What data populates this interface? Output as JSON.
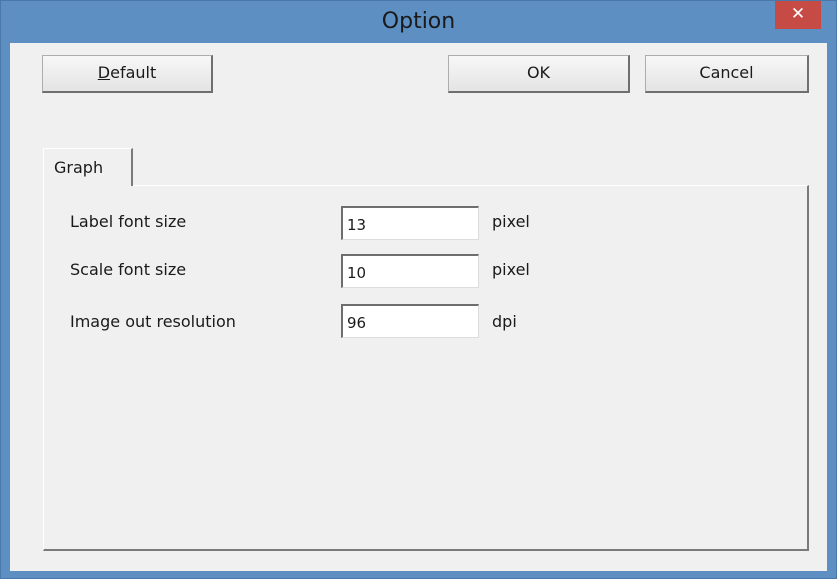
{
  "window": {
    "title": "Option",
    "close_glyph": "✕"
  },
  "buttons": {
    "default_label_underlined": "D",
    "default_label_rest": "efault",
    "ok_label": "OK",
    "cancel_label": "Cancel"
  },
  "tabs": [
    {
      "label": "Graph",
      "active": true
    }
  ],
  "settings": [
    {
      "label": "Label font size",
      "value": "13",
      "unit": "pixel"
    },
    {
      "label": "Scale font size",
      "value": "10",
      "unit": "pixel"
    },
    {
      "label": "Image out resolution",
      "value": "96",
      "unit": "dpi"
    }
  ],
  "colors": {
    "titlebar": "#5d8fc2",
    "close_button": "#c74b45",
    "client_background": "#f0f0f0"
  }
}
